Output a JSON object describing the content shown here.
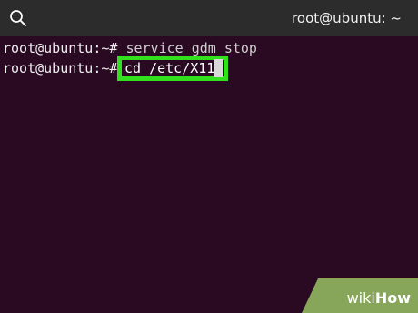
{
  "window": {
    "title": "root@ubuntu: ~"
  },
  "terminal": {
    "line1_prompt": "root@ubuntu:~#",
    "line1_command": " service gdm stop",
    "line2_prompt": "root@ubuntu:~#",
    "line2_command": "cd /etc/X11"
  },
  "watermark": {
    "part1": "wiki",
    "part2": "How"
  },
  "icons": {
    "search": "search-icon"
  },
  "colors": {
    "terminal_background": "#2a0922",
    "titlebar_background": "#2c2c2c",
    "highlight": "#33e01e"
  }
}
